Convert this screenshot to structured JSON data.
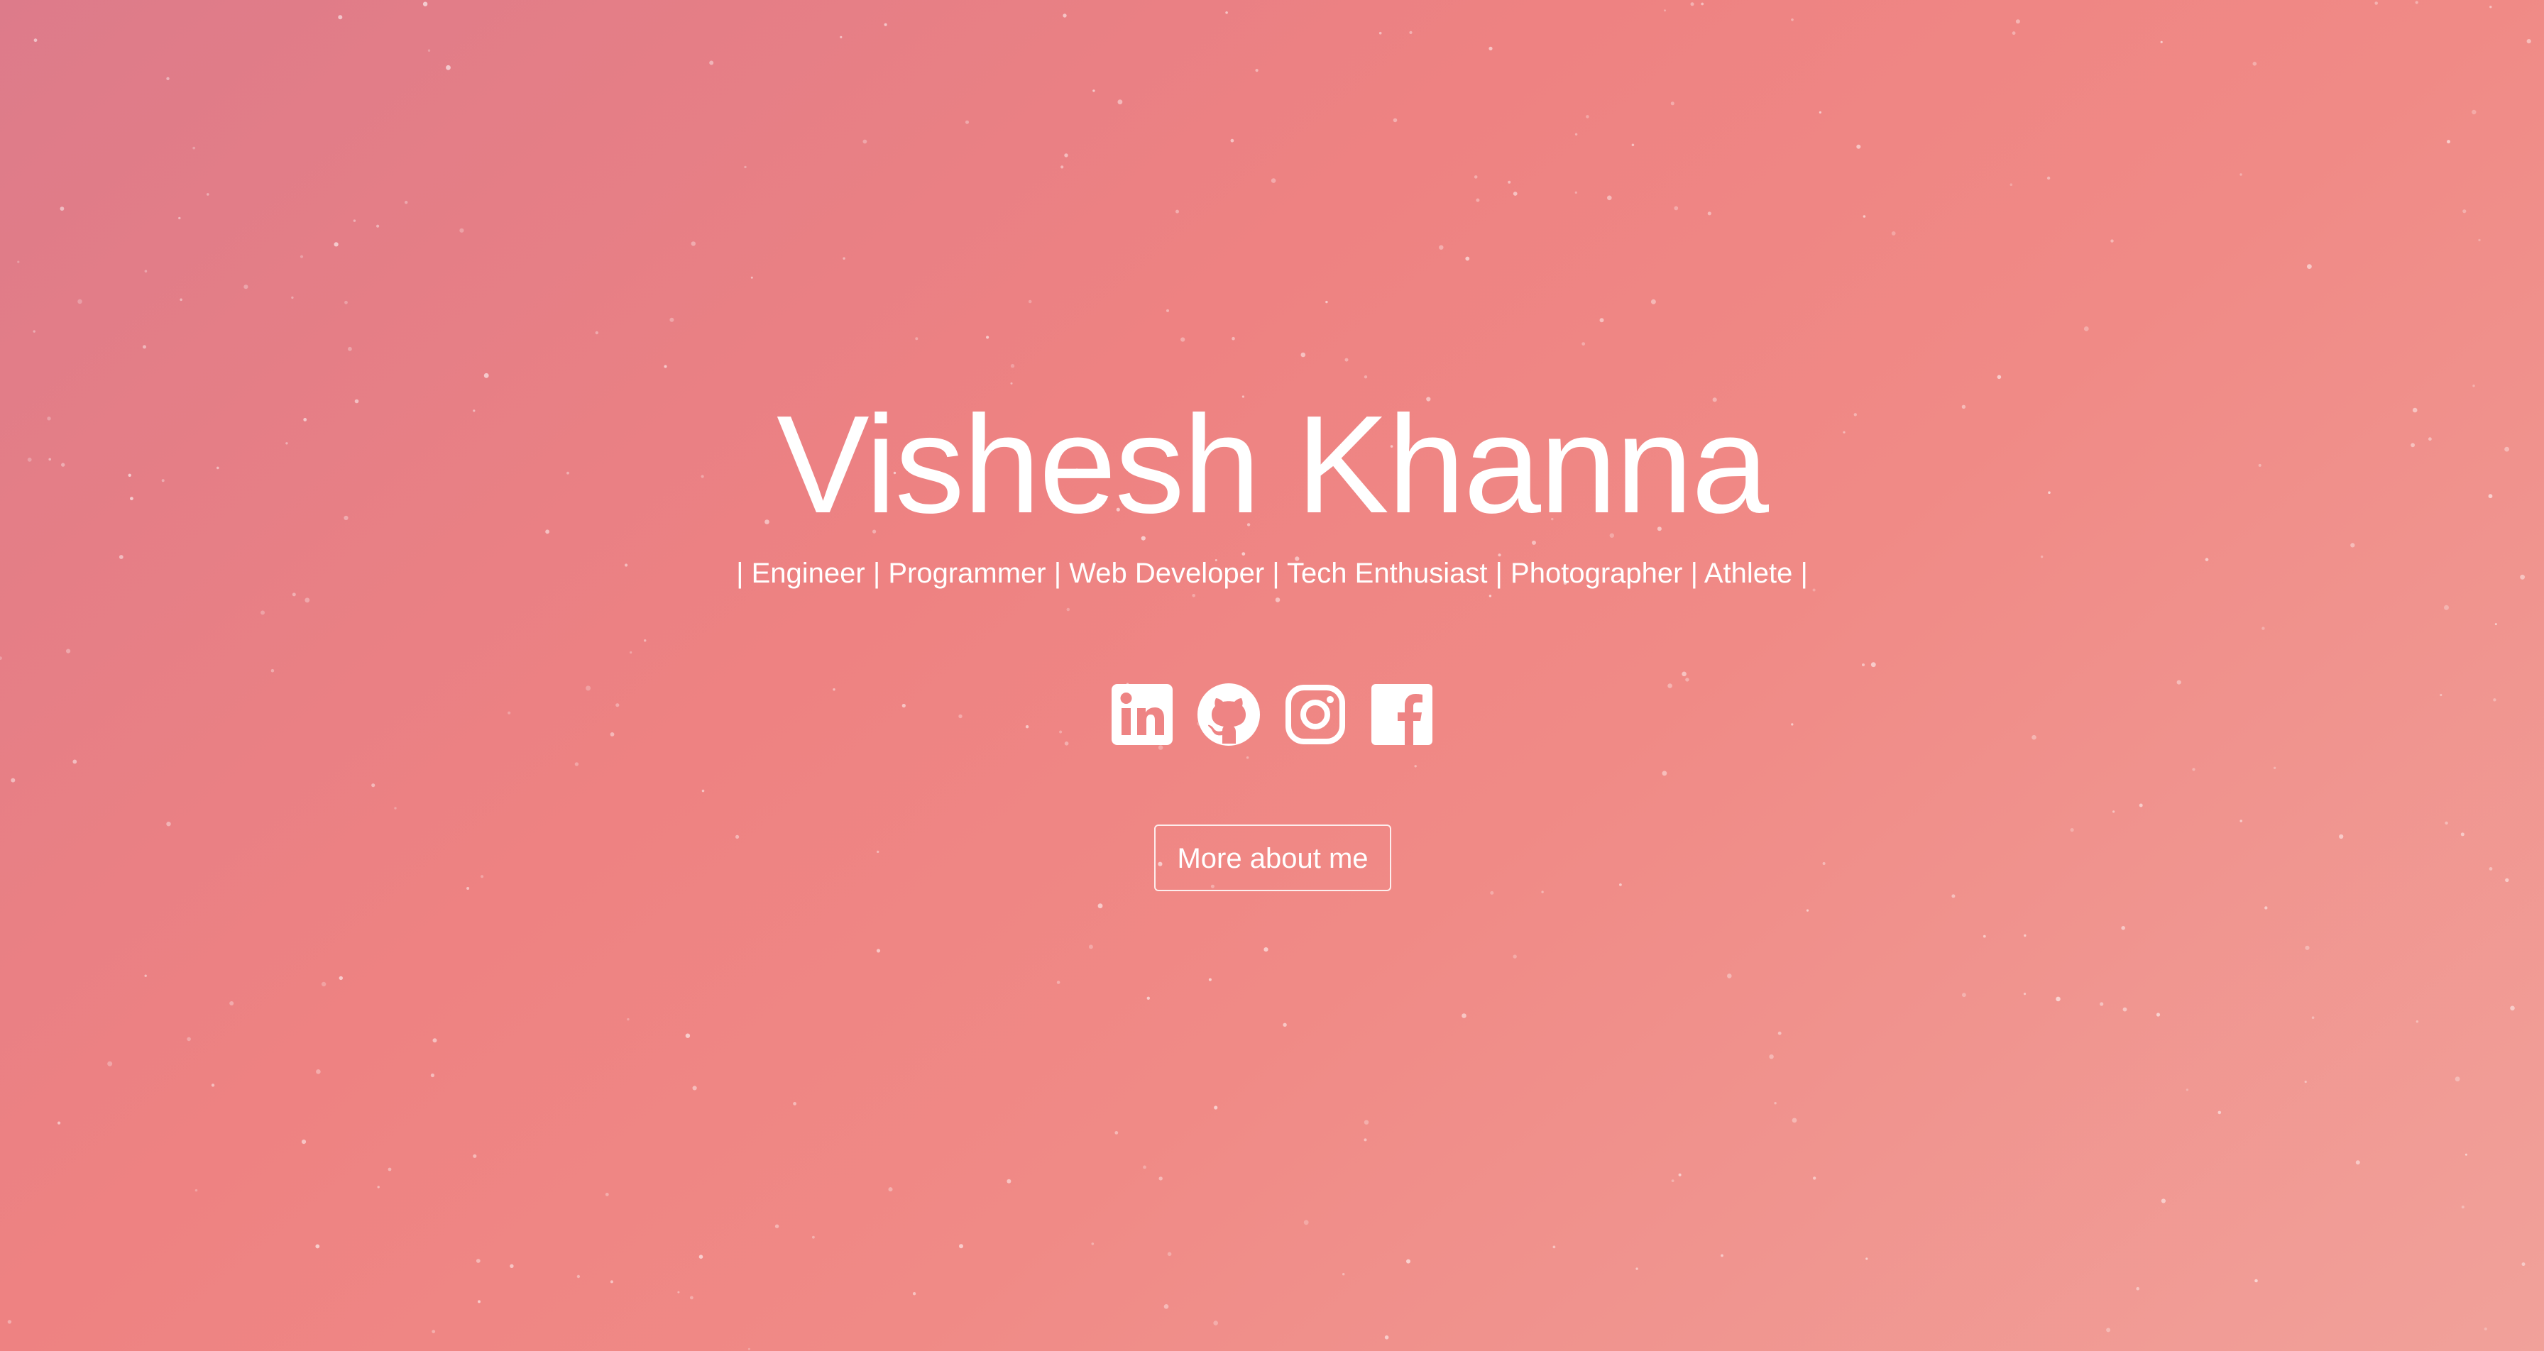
{
  "hero": {
    "name": "Vishesh Khanna",
    "tagline": "| Engineer | Programmer | Web Developer | Tech Enthusiast | Photographer | Athlete |",
    "background_colors": [
      "#dd7b8a",
      "#ee8282",
      "#f08a86",
      "#f1a19a"
    ],
    "text_color": "#ffffff"
  },
  "socials": [
    {
      "name": "LinkedIn",
      "icon": "linkedin-icon"
    },
    {
      "name": "GitHub",
      "icon": "github-icon"
    },
    {
      "name": "Instagram",
      "icon": "instagram-icon"
    },
    {
      "name": "Facebook",
      "icon": "facebook-icon"
    }
  ],
  "cta": {
    "label": "More about me"
  }
}
